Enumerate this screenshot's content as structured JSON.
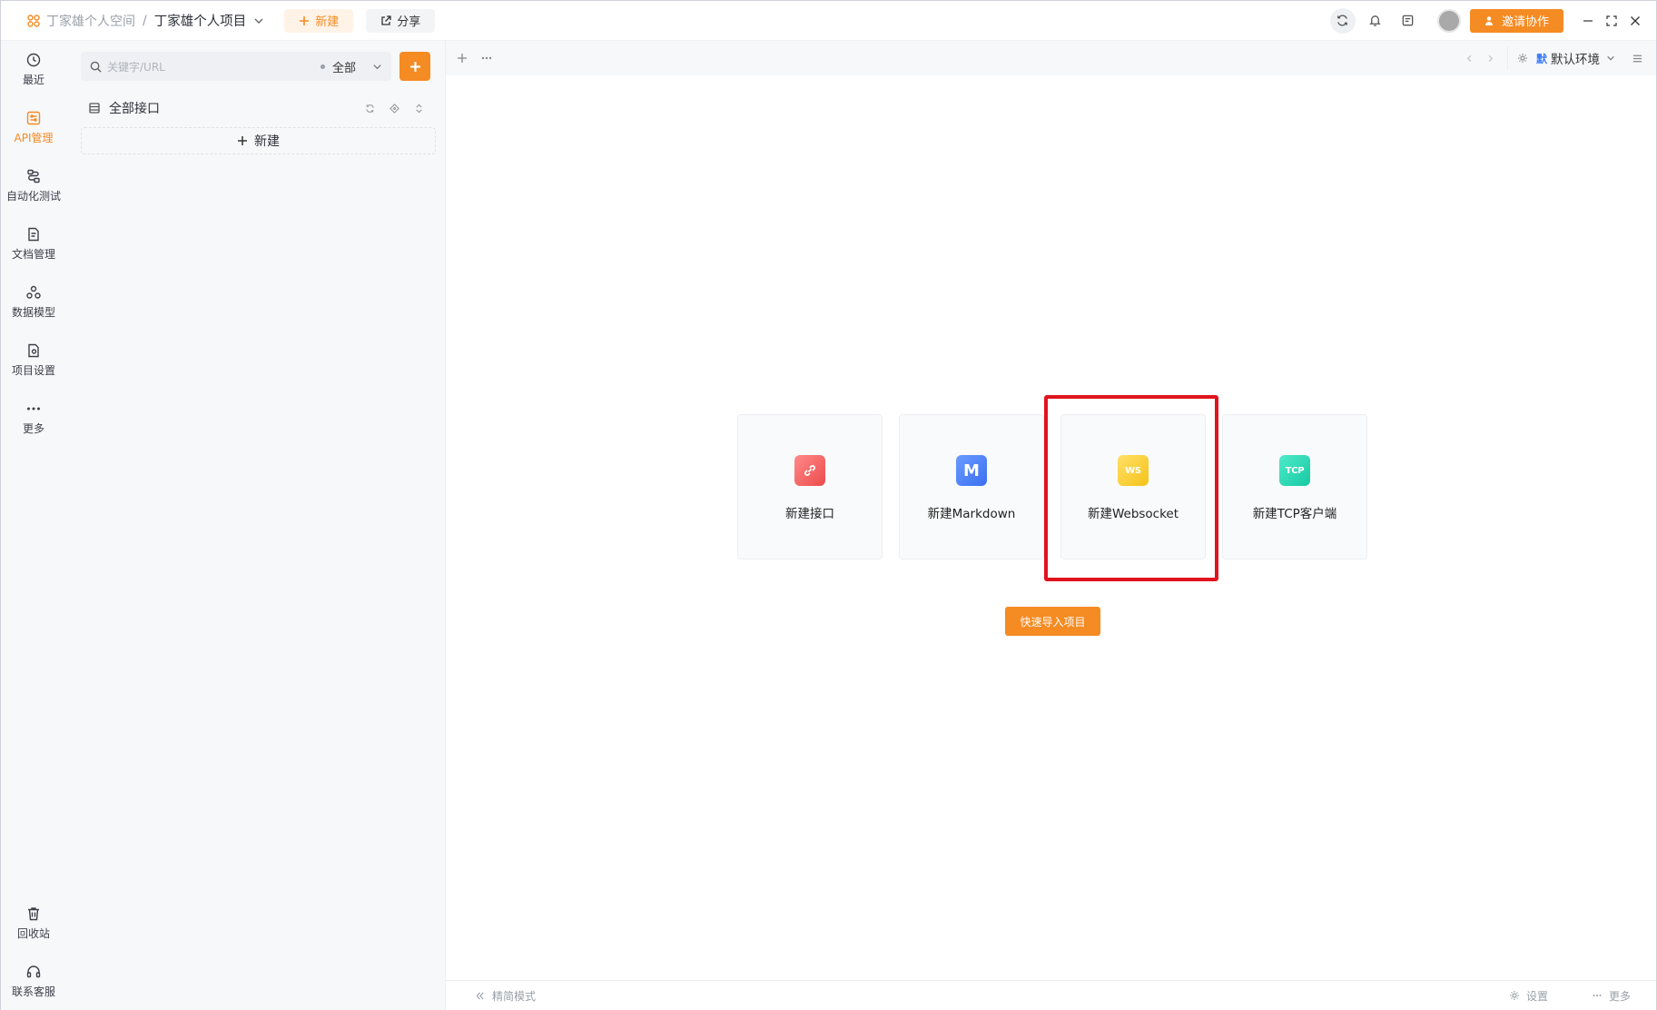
{
  "titlebar": {
    "workspace": "丁家雄个人空间",
    "separator": "/",
    "project": "丁家雄个人项目",
    "new_label": "新建",
    "share_label": "分享",
    "invite_label": "邀请协作"
  },
  "leftnav": {
    "items": [
      {
        "label": "最近",
        "icon": "clock-icon"
      },
      {
        "label": "API管理",
        "icon": "api-icon"
      },
      {
        "label": "自动化测试",
        "icon": "flow-icon"
      },
      {
        "label": "文档管理",
        "icon": "document-icon"
      },
      {
        "label": "数据模型",
        "icon": "model-icon"
      },
      {
        "label": "项目设置",
        "icon": "settings-icon"
      },
      {
        "label": "更多",
        "icon": "more-icon"
      }
    ],
    "bottom": [
      {
        "label": "回收站",
        "icon": "trash-icon"
      },
      {
        "label": "联系客服",
        "icon": "headset-icon"
      }
    ]
  },
  "tree": {
    "search_placeholder": "关键字/URL",
    "filter_value": "全部",
    "all_interfaces": "全部接口",
    "new_label": "新建"
  },
  "tabbar": {
    "env_tag": "默",
    "env_label": "默认环境"
  },
  "cards": [
    {
      "label": "新建接口",
      "icon": "link-icon"
    },
    {
      "label": "新建Markdown",
      "icon": "markdown-icon",
      "badge": "M"
    },
    {
      "label": "新建Websocket",
      "icon": "websocket-icon",
      "badge": "WS"
    },
    {
      "label": "新建TCP客户端",
      "icon": "tcp-icon",
      "badge": "TCP"
    }
  ],
  "import_label": "快速导入项目",
  "statusbar": {
    "simple_mode": "精简模式",
    "settings": "设置",
    "more": "更多"
  },
  "colors": {
    "accent": "#f58b23",
    "highlight": "#e0141e"
  }
}
